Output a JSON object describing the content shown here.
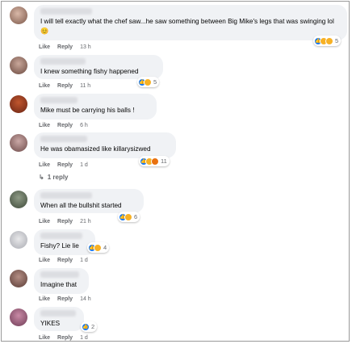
{
  "actions": {
    "like": "Like",
    "reply": "Reply"
  },
  "comments": [
    {
      "text": "I will tell exactly what the chef saw...he saw something between Big Mike's legs that was swinging lol 😊",
      "time": "13 h",
      "reaction_count": "5"
    },
    {
      "text": "I knew something fishy happened",
      "time": "11 h",
      "reaction_count": "5"
    },
    {
      "text": "Mike must be carrying his balls !",
      "time": "6 h",
      "reaction_count": ""
    },
    {
      "text": "He was obamasized like killarysizwed",
      "time": "1 d",
      "reaction_count": "11",
      "replies": "1 reply"
    },
    {
      "text": "When all the bullshit started",
      "time": "21 h",
      "reaction_count": "6"
    },
    {
      "text": "Fishy? Lie lie",
      "time": "1 d",
      "reaction_count": "4"
    },
    {
      "text": "Imagine that",
      "time": "14 h",
      "reaction_count": ""
    },
    {
      "text": "YIKES",
      "time": "1 d",
      "reaction_count": "2"
    }
  ],
  "colors": {
    "like": "#1877f2",
    "haha": "#f7b125",
    "angry": "#e9710f",
    "bubble": "#f0f2f5"
  }
}
